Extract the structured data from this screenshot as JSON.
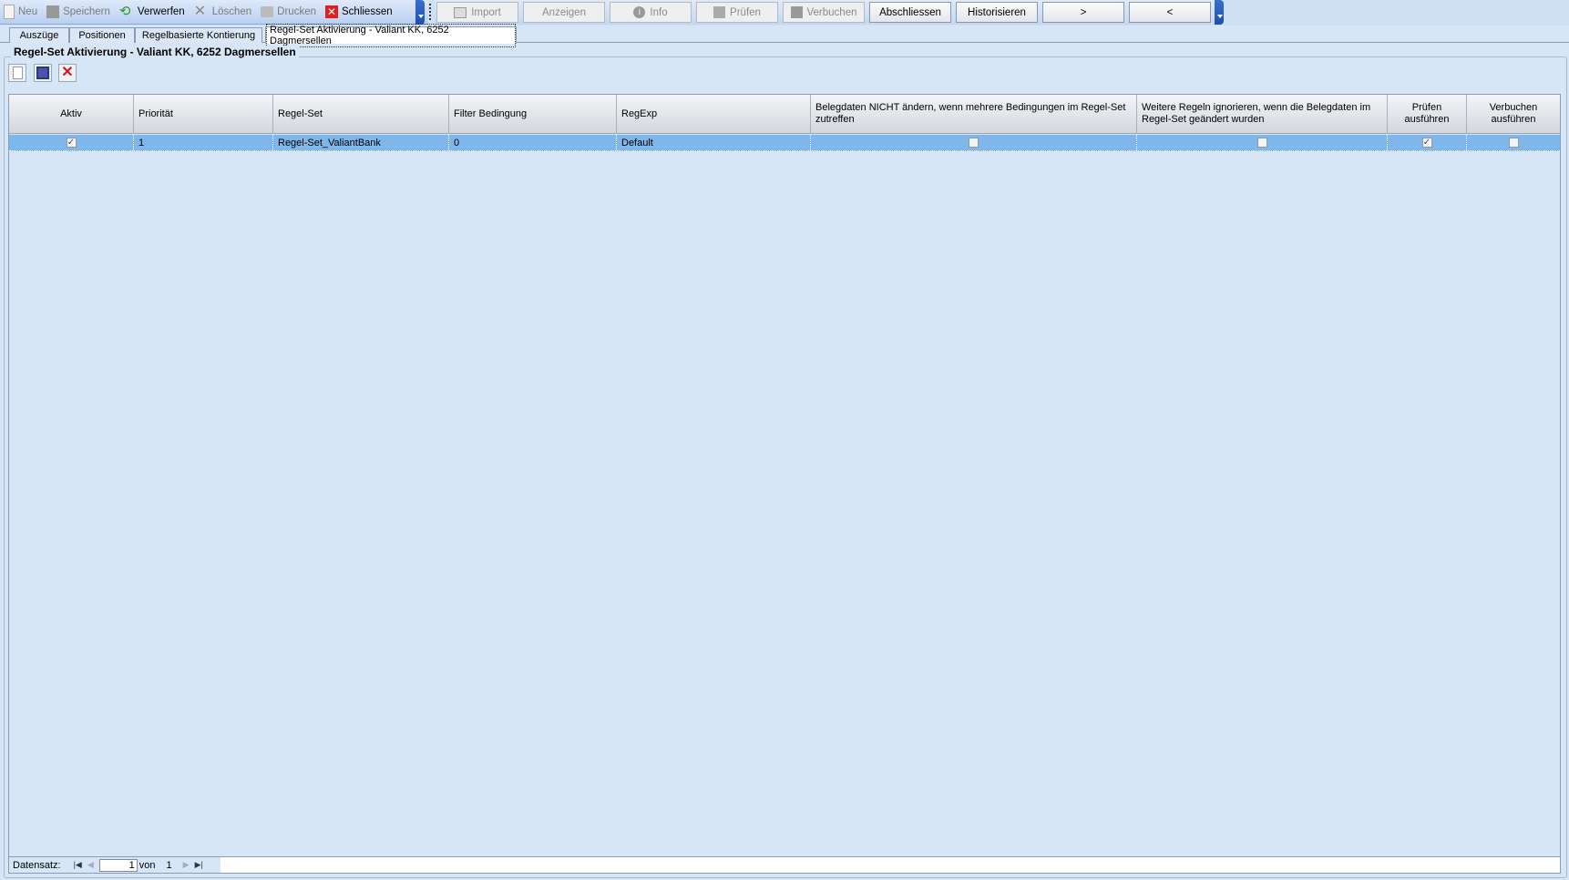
{
  "toolbar": {
    "items": [
      {
        "label": "Neu",
        "enabled": false
      },
      {
        "label": "Speichern",
        "enabled": false
      },
      {
        "label": "Verwerfen",
        "enabled": true
      },
      {
        "label": "Löschen",
        "enabled": false
      },
      {
        "label": "Drucken",
        "enabled": false
      },
      {
        "label": "Schliessen",
        "enabled": true
      }
    ]
  },
  "actions": [
    {
      "label": "Import"
    },
    {
      "label": "Anzeigen"
    },
    {
      "label": "Info"
    },
    {
      "label": "Prüfen"
    },
    {
      "label": "Verbuchen"
    },
    {
      "label": "Abschliessen"
    },
    {
      "label": "Historisieren"
    },
    {
      "label": ">"
    },
    {
      "label": "<"
    }
  ],
  "tabs": [
    "Auszüge",
    "Positionen",
    "Regelbasierte Kontierung",
    "Regel-Set Aktivierung - Valiant KK, 6252 Dagmersellen"
  ],
  "group_title": "Regel-Set Aktivierung - Valiant KK, 6252 Dagmersellen",
  "grid": {
    "columns": [
      "Aktiv",
      "Priorität",
      "Regel-Set",
      "Filter Bedingung",
      "RegExp",
      "Belegdaten NICHT ändern, wenn mehrere Bedingungen im Regel-Set zutreffen",
      "Weitere Regeln ignorieren, wenn die Belegdaten im Regel-Set geändert wurden",
      "Prüfen ausführen",
      "Verbuchen ausführen"
    ],
    "rows": [
      {
        "aktiv": "✓",
        "prioritaet": "1",
        "regelset": "Regel-Set_ValiantBank",
        "filter": "0",
        "regexp": "Default",
        "nicht_aendern": "",
        "ignorieren": "",
        "pruefen": "✓",
        "verbuchen": ""
      }
    ]
  },
  "navigator": {
    "label": "Datensatz:",
    "current": "1",
    "of_label": "von",
    "total": "1"
  }
}
